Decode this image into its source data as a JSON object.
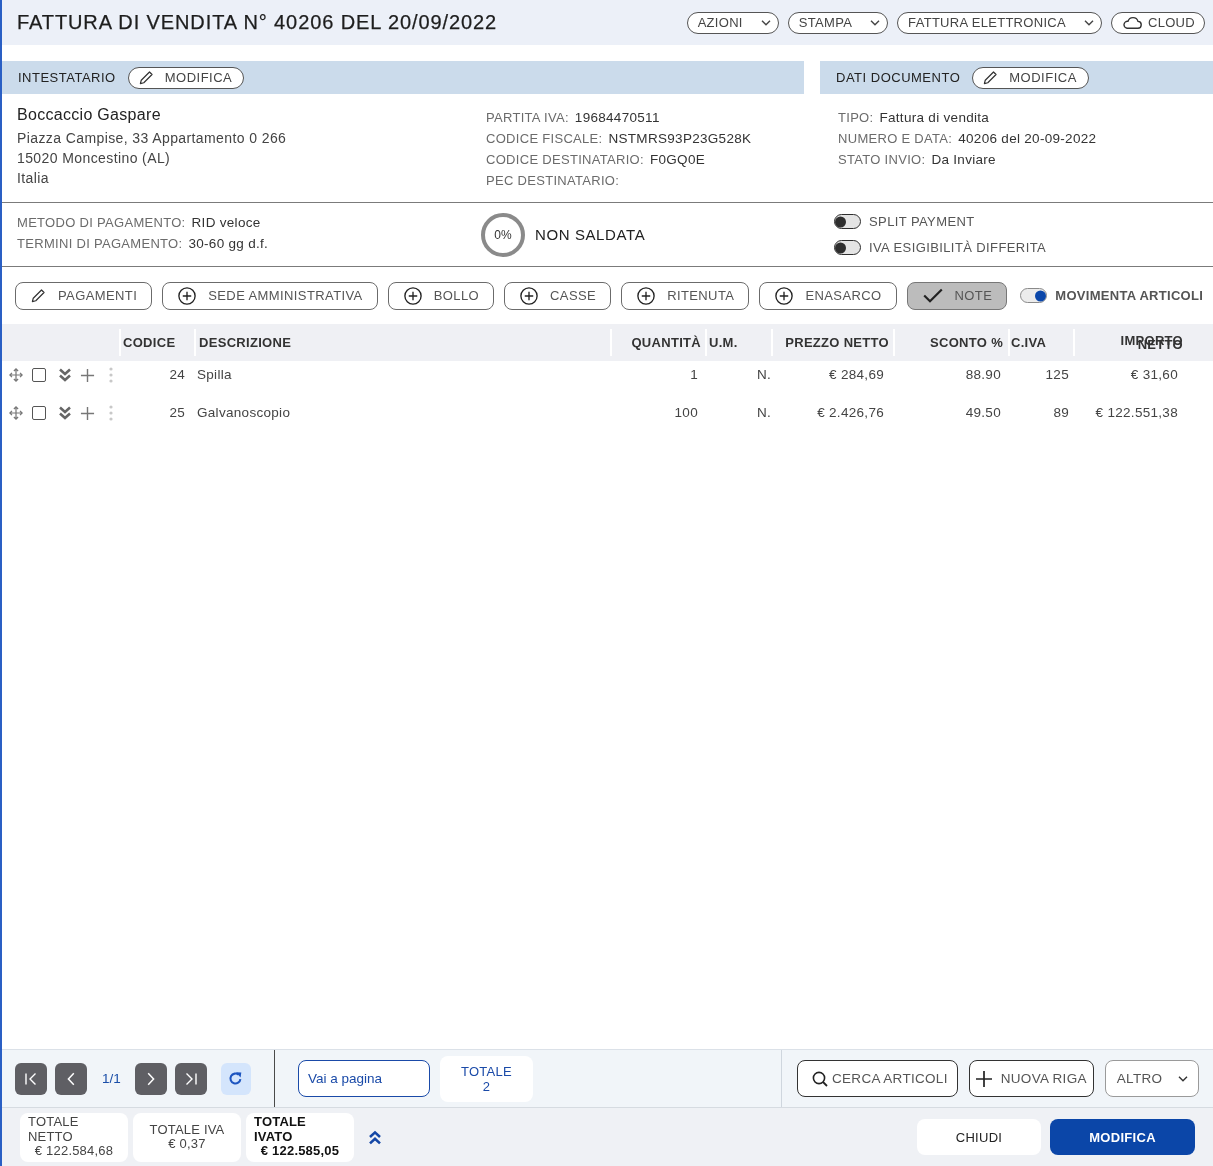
{
  "header": {
    "title": "FATTURA DI VENDITA N° 40206 DEL 20/09/2022",
    "actions": [
      {
        "label": "AZIONI",
        "kind": "dropdown"
      },
      {
        "label": "STAMPA",
        "kind": "dropdown"
      },
      {
        "label": "FATTURA ELETTRONICA",
        "kind": "dropdown"
      },
      {
        "label": "CLOUD",
        "kind": "cloud"
      }
    ]
  },
  "customer_panel": {
    "title": "INTESTATARIO",
    "edit_label": "MODIFICA",
    "name": "Boccaccio Gaspare",
    "address_lines": [
      "Piazza Campise, 33 Appartamento 0 266",
      "15020 Moncestino (AL)",
      "Italia"
    ],
    "fields": [
      {
        "label": "PARTITA IVA:",
        "value": "19684470511"
      },
      {
        "label": "CODICE FISCALE:",
        "value": "NSTMRS93P23G528K"
      },
      {
        "label": "CODICE DESTINATARIO:",
        "value": "F0GQ0E"
      },
      {
        "label": "PEC DESTINATARIO:"
      }
    ]
  },
  "document_panel": {
    "title": "DATI DOCUMENTO",
    "edit_label": "MODIFICA",
    "fields": [
      {
        "label": "TIPO:",
        "value": "Fattura di vendita"
      },
      {
        "label": "NUMERO E DATA:",
        "value": "40206 del 20-09-2022"
      },
      {
        "label": "STATO INVIO:",
        "value": "Da Inviare"
      }
    ]
  },
  "payment": {
    "fields": [
      {
        "label": "METODO DI PAGAMENTO:",
        "value": "RID veloce"
      },
      {
        "label": "TERMINI DI PAGAMENTO:",
        "value": "30-60 gg d.f."
      }
    ],
    "progress": {
      "reading": "0%",
      "status": "NON SALDATA"
    },
    "switches": [
      {
        "label": "SPLIT PAYMENT",
        "on": false
      },
      {
        "label": "IVA ESIGIBILITÀ DIFFERITA",
        "on": false
      }
    ]
  },
  "toolbar": {
    "buttons": [
      {
        "label": "PAGAMENTI",
        "kind": "edit",
        "selected": false
      },
      {
        "label": "SEDE AMMINISTRATIVA",
        "kind": "add",
        "selected": false
      },
      {
        "label": "BOLLO",
        "kind": "add",
        "selected": false
      },
      {
        "label": "CASSE",
        "kind": "add",
        "selected": false
      },
      {
        "label": "RITENUTA",
        "kind": "add",
        "selected": false
      },
      {
        "label": "ENASARCO",
        "kind": "add",
        "selected": false
      },
      {
        "label": "NOTE",
        "kind": "check",
        "selected": true
      }
    ],
    "switch": {
      "label": "MOVIMENTA ARTICOLI",
      "on": true
    }
  },
  "table": {
    "columns": [
      "CODICE",
      "DESCRIZIONE",
      "QUANTITÀ",
      "U.M.",
      "PREZZO NETTO",
      "SCONTO %",
      "C.IVA",
      "IMPORTO NETTO"
    ],
    "rows": [
      {
        "checked": false,
        "cells": [
          "24",
          "Spilla",
          "1",
          "N.",
          "€ 284,69",
          "88.90",
          "125",
          "€ 31,60"
        ]
      },
      {
        "checked": false,
        "cells": [
          "25",
          "Galvanoscopio",
          "100",
          "N.",
          "€ 2.426,76",
          "49.50",
          "89",
          "€ 122.551,38"
        ]
      }
    ]
  },
  "pager": {
    "page": "1/1",
    "goto_placeholder": "Vai a pagina",
    "count": {
      "label": "TOTALE",
      "value": "2"
    },
    "buttons": [
      {
        "label": "CERCA ARTICOLI",
        "kind": "search"
      },
      {
        "label": "NUOVA RIGA",
        "kind": "add"
      },
      {
        "label": "ALTRO",
        "kind": "dropdown"
      }
    ]
  },
  "footer": {
    "totals": [
      {
        "label": "TOTALE NETTO",
        "value": "€ 122.584,68",
        "emphasis": false
      },
      {
        "label": "TOTALE IVA",
        "value": "€ 0,37",
        "emphasis": false
      },
      {
        "label": "TOTALE IVATO",
        "value": "€ 122.585,05",
        "emphasis": true
      }
    ],
    "buttons": [
      {
        "label": "CHIUDI",
        "kind": "close"
      },
      {
        "label": "MODIFICA",
        "kind": "edit"
      }
    ]
  }
}
